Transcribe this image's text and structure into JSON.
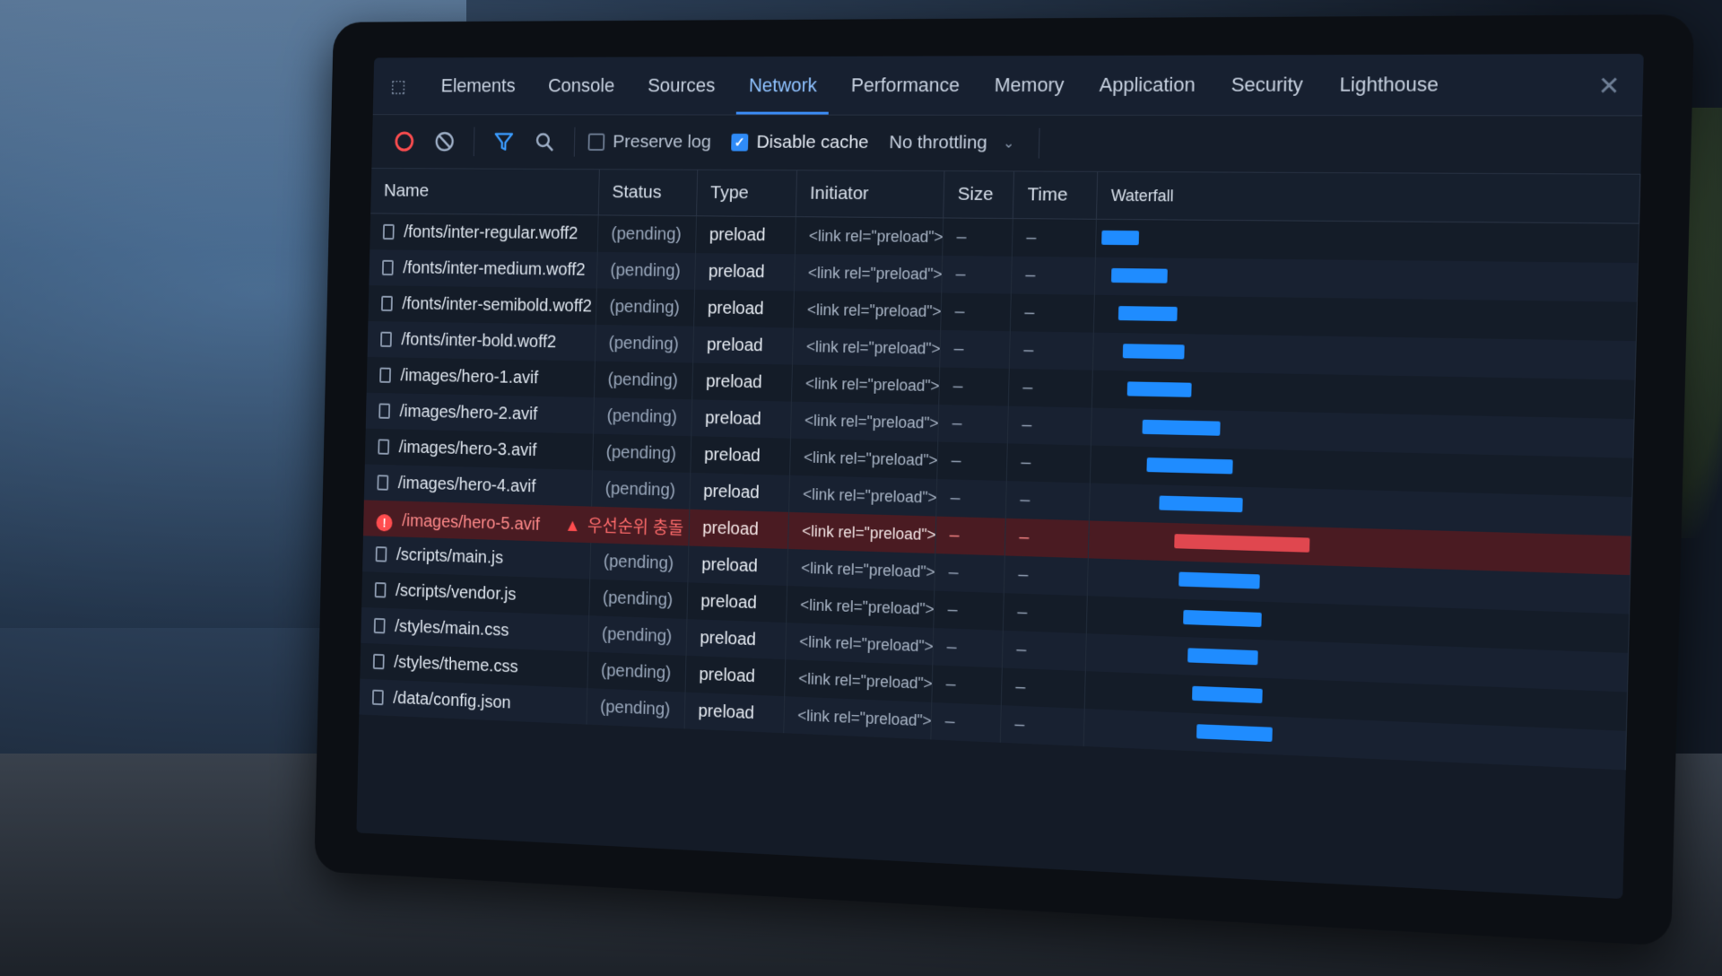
{
  "tabs": [
    "Elements",
    "Console",
    "Sources",
    "Network",
    "Performance",
    "Memory",
    "Application",
    "Security",
    "Lighthouse"
  ],
  "active_tab": "Network",
  "toolbar": {
    "preserve_log": "Preserve log",
    "disable_cache": "Disable cache",
    "throttling": "No throttling"
  },
  "columns": {
    "name": "Name",
    "status": "Status",
    "type": "Type",
    "initiator": "Initiator",
    "size": "Size",
    "time": "Time",
    "waterfall": "Waterfall"
  },
  "rows": [
    {
      "name": "/fonts/inter-regular.woff2",
      "status": "(pending)",
      "type": "preload",
      "initiator": "<link rel=\"preload\">",
      "size": "–",
      "time": "–",
      "wf_start": 0.02,
      "wf_end": 0.16
    },
    {
      "name": "/fonts/inter-medium.woff2",
      "status": "(pending)",
      "type": "preload",
      "initiator": "<link rel=\"preload\">",
      "size": "–",
      "time": "–",
      "wf_start": 0.06,
      "wf_end": 0.27
    },
    {
      "name": "/fonts/inter-semibold.woff2",
      "status": "(pending)",
      "type": "preload",
      "initiator": "<link rel=\"preload\">",
      "size": "–",
      "time": "–",
      "wf_start": 0.09,
      "wf_end": 0.31
    },
    {
      "name": "/fonts/inter-bold.woff2",
      "status": "(pending)",
      "type": "preload",
      "initiator": "<link rel=\"preload\">",
      "size": "–",
      "time": "–",
      "wf_start": 0.11,
      "wf_end": 0.34
    },
    {
      "name": "/images/hero-1.avif",
      "status": "(pending)",
      "type": "preload",
      "initiator": "<link rel=\"preload\">",
      "size": "–",
      "time": "–",
      "wf_start": 0.13,
      "wf_end": 0.37
    },
    {
      "name": "/images/hero-2.avif",
      "status": "(pending)",
      "type": "preload",
      "initiator": "<link rel=\"preload\">",
      "size": "–",
      "time": "–",
      "wf_start": 0.19,
      "wf_end": 0.48
    },
    {
      "name": "/images/hero-3.avif",
      "status": "(pending)",
      "type": "preload",
      "initiator": "<link rel=\"preload\">",
      "size": "–",
      "time": "–",
      "wf_start": 0.21,
      "wf_end": 0.53
    },
    {
      "name": "/images/hero-4.avif",
      "status": "(pending)",
      "type": "preload",
      "initiator": "<link rel=\"preload\">",
      "size": "–",
      "time": "–",
      "wf_start": 0.26,
      "wf_end": 0.57
    },
    {
      "name": "/images/hero-5.avif",
      "status": "",
      "type": "preload",
      "initiator": "<link rel=\"preload\">",
      "size": "–",
      "time": "–",
      "wf_start": 0.32,
      "wf_end": 0.82,
      "error": true,
      "warning": "우선순위 충돌"
    },
    {
      "name": "/scripts/main.js",
      "status": "(pending)",
      "type": "preload",
      "initiator": "<link rel=\"preload\">",
      "size": "–",
      "time": "–",
      "wf_start": 0.34,
      "wf_end": 0.64
    },
    {
      "name": "/scripts/vendor.js",
      "status": "(pending)",
      "type": "preload",
      "initiator": "<link rel=\"preload\">",
      "size": "–",
      "time": "–",
      "wf_start": 0.36,
      "wf_end": 0.65
    },
    {
      "name": "/styles/main.css",
      "status": "(pending)",
      "type": "preload",
      "initiator": "<link rel=\"preload\">",
      "size": "–",
      "time": "–",
      "wf_start": 0.38,
      "wf_end": 0.64
    },
    {
      "name": "/styles/theme.css",
      "status": "(pending)",
      "type": "preload",
      "initiator": "<link rel=\"preload\">",
      "size": "–",
      "time": "–",
      "wf_start": 0.4,
      "wf_end": 0.66
    },
    {
      "name": "/data/config.json",
      "status": "(pending)",
      "type": "preload",
      "initiator": "<link rel=\"preload\">",
      "size": "–",
      "time": "–",
      "wf_start": 0.42,
      "wf_end": 0.7
    }
  ]
}
